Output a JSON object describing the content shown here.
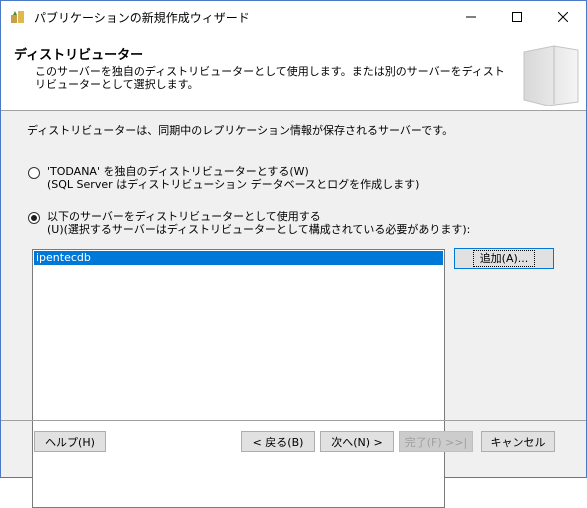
{
  "window": {
    "title": "パブリケーションの新規作成ウィザード",
    "icons": {
      "app": "wizard-app-icon",
      "minimize": "minimize-icon",
      "maximize": "maximize-icon",
      "close": "close-icon"
    }
  },
  "header": {
    "title": "ディストリビューター",
    "description": "このサーバーを独自のディストリビューターとして使用します。または別のサーバーをディストリビューターとして選択します。"
  },
  "content": {
    "intro": "ディストリビューターは、同期中のレプリケーション情報が保存されるサーバーです。",
    "options": [
      {
        "line1": "'TODANA' を独自のディストリビューターとする(W)",
        "line2": "(SQL Server はディストリビューション データベースとログを作成します)",
        "selected": false
      },
      {
        "line1": "以下のサーバーをディストリビューターとして使用する",
        "line2": "(U)(選択するサーバーはディストリビューターとして構成されている必要があります):",
        "selected": true
      }
    ],
    "server_list": [
      {
        "name": "ipentecdb",
        "selected": true
      }
    ],
    "add_button": "追加(A)..."
  },
  "footer": {
    "help": "ヘルプ(H)",
    "back": "< 戻る(B)",
    "next": "次へ(N) >",
    "finish": "完了(F) >>|",
    "cancel": "キャンセル"
  },
  "colors": {
    "selection": "#0078d7",
    "border": "#4a79c5"
  }
}
